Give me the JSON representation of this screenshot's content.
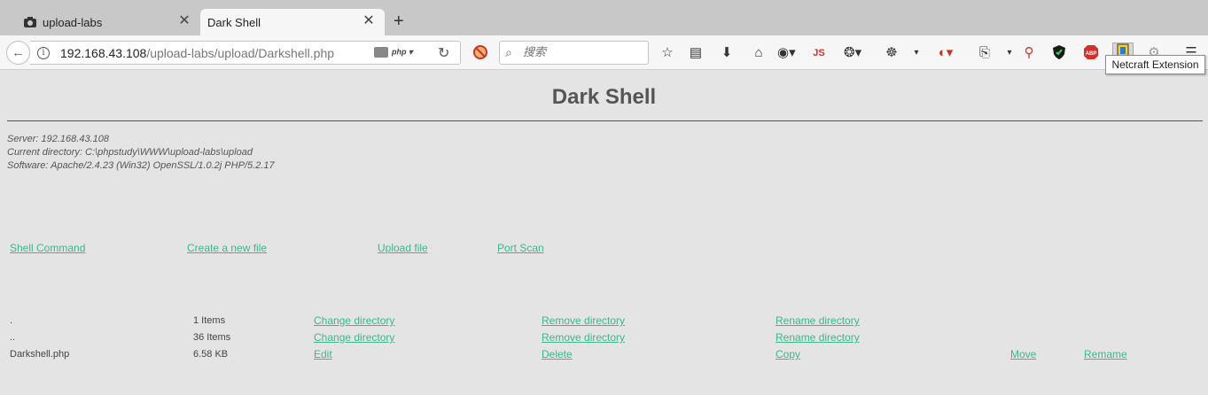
{
  "browser": {
    "tabs": [
      {
        "label": "upload-labs",
        "active": false
      },
      {
        "label": "Dark Shell",
        "active": true
      }
    ],
    "url_host": "192.168.43.108",
    "url_path": "/upload-labs/upload/Darkshell.php",
    "php_indicator": "php",
    "search_placeholder": "搜索",
    "toolbar_js_label": "JS",
    "toolbar_abp_label": "ABP",
    "tooltip": "Netcraft Extension"
  },
  "page": {
    "title": "Dark Shell",
    "server_line": "Server: 192.168.43.108",
    "directory_line": "Current directory: C:\\phpstudy\\WWW\\upload-labs\\upload",
    "software_line": "Software: Apache/2.4.23 (Win32) OpenSSL/1.0.2j PHP/5.2.17",
    "menu": [
      "Shell Command",
      "Create a new file",
      "Upload file",
      "Port Scan"
    ],
    "files": [
      {
        "name": ".",
        "size": "1 Items",
        "a1": "Change directory",
        "a2": "Remove directory",
        "a3": "Rename directory",
        "a4": "",
        "a5": ""
      },
      {
        "name": "..",
        "size": "36 Items",
        "a1": "Change directory",
        "a2": "Remove directory",
        "a3": "Rename directory",
        "a4": "",
        "a5": ""
      },
      {
        "name": "Darkshell.php",
        "size": "6.58 KB",
        "a1": "Edit",
        "a2": "Delete",
        "a3": "Copy",
        "a4": "Move",
        "a5": "Remame"
      }
    ]
  },
  "colors": {
    "link": "#3cb88a",
    "background": "#e4e4e4"
  }
}
